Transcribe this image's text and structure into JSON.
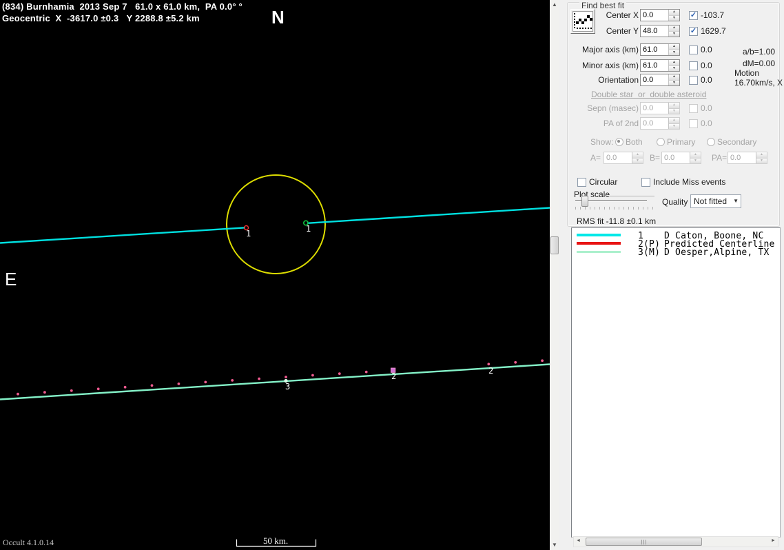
{
  "window": {
    "app_version": "Occult 4.1.0.14"
  },
  "plot": {
    "title_line1": "(834) Burnhamia  2013 Sep 7   61.0 x 61.0 km,  PA 0.0° °",
    "title_line2": "Geocentric  X  -3617.0 ±0.3   Y 2288.8 ±5.2 km",
    "north_label": "N",
    "east_label": "E",
    "scale_label": "50 km.",
    "chord1_label": "1",
    "chord2_label": "2",
    "chord3_label": "3",
    "colors": {
      "background": "#000000",
      "asteroid_outline": "#dddd00",
      "chord1": "#00e0e0",
      "chord2_dots": "#ef5a8f",
      "chord3": "#84f2c8",
      "disappearance_marker": "#f03030",
      "reappearance_marker": "#10c040"
    }
  },
  "panel": {
    "group_title": "Find best fit",
    "fit_button_icon": "scatter-fit-icon",
    "fit_rows": [
      {
        "label": "Center X",
        "value": "0.0",
        "checked": true,
        "result": "-103.7"
      },
      {
        "label": "Center Y",
        "value": "48.0",
        "checked": true,
        "result": "1629.7"
      },
      {
        "label": "Major axis (km)",
        "value": "61.0",
        "checked": false,
        "result": "0.0"
      },
      {
        "label": "Minor axis (km)",
        "value": "61.0",
        "checked": false,
        "result": "0.0"
      },
      {
        "label": "Orientation",
        "value": "0.0",
        "checked": false,
        "result": "0.0"
      }
    ],
    "stats": {
      "ab_ratio": "a/b=1.00",
      "dm": "dM=0.00",
      "motion_label": "Motion",
      "motion_value": "16.70km/s, X"
    },
    "double_section": {
      "heading": "Double star  or  double asteroid",
      "rows": [
        {
          "label": "Sepn (masec)",
          "value": "0.0",
          "checked": false,
          "result": "0.0"
        },
        {
          "label": "PA of 2nd",
          "value": "0.0",
          "checked": false,
          "result": "0.0"
        }
      ],
      "show_label": "Show:",
      "radios": [
        {
          "label": "Both",
          "selected": true
        },
        {
          "label": "Primary",
          "selected": false
        },
        {
          "label": "Secondary",
          "selected": false
        }
      ],
      "abpa": [
        {
          "label": "A=",
          "value": "0.0"
        },
        {
          "label": "B=",
          "value": "0.0"
        },
        {
          "label": "PA=",
          "value": "0.0"
        }
      ]
    },
    "circular_label": "Circular",
    "include_miss_label": "Include Miss events",
    "plot_scale_label": "Plot scale",
    "quality_label": "Quality",
    "quality_value": "Not fitted",
    "rms_label": "RMS fit -11.8 ±0.1 km",
    "legend": [
      {
        "num": "1",
        "desc": "D Caton, Boone, NC",
        "color": "#00e8e8"
      },
      {
        "num": "2(P)",
        "desc": "Predicted Centerline",
        "color": "#e81414"
      },
      {
        "num": "3(M)",
        "desc": "D Oesper,Alpine, TX",
        "color": "#abf0cd"
      }
    ]
  },
  "icons": {
    "check": "✓",
    "spin_up": "▲",
    "spin_down": "▼",
    "scroll_up": "▲",
    "scroll_down": "▼",
    "scroll_left": "◄",
    "scroll_right": "►",
    "dropdown_arrow": "▼"
  }
}
